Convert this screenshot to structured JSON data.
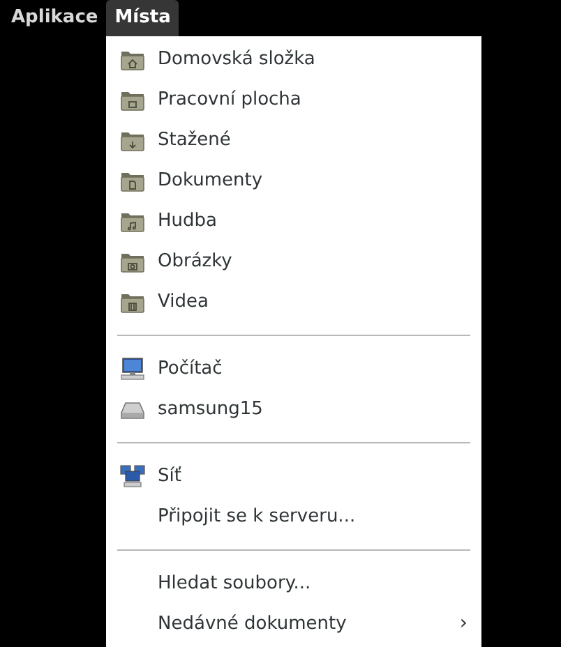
{
  "top_bar": {
    "menus": [
      {
        "label": "Aplikace",
        "selected": false
      },
      {
        "label": "Místa",
        "selected": true
      }
    ]
  },
  "places_menu": {
    "sections": [
      {
        "items": [
          {
            "label": "Domovská složka",
            "kind": "home"
          },
          {
            "label": "Pracovní plocha",
            "kind": "desktop"
          },
          {
            "label": "Stažené",
            "kind": "download"
          },
          {
            "label": "Dokumenty",
            "kind": "document"
          },
          {
            "label": "Hudba",
            "kind": "music"
          },
          {
            "label": "Obrázky",
            "kind": "camera"
          },
          {
            "label": "Videa",
            "kind": "film"
          }
        ]
      },
      {
        "items": [
          {
            "label": "Počítač",
            "kind": "computer"
          },
          {
            "label": "samsung15",
            "kind": "drive"
          }
        ]
      },
      {
        "items": [
          {
            "label": "Síť",
            "kind": "network"
          },
          {
            "label": "Připojit se k serveru...",
            "kind": "plain"
          }
        ]
      },
      {
        "items": [
          {
            "label": "Hledat soubory...",
            "kind": "plain"
          },
          {
            "label": "Nedávné dokumenty",
            "kind": "plain",
            "submenu_indicator": "›"
          }
        ]
      }
    ]
  }
}
